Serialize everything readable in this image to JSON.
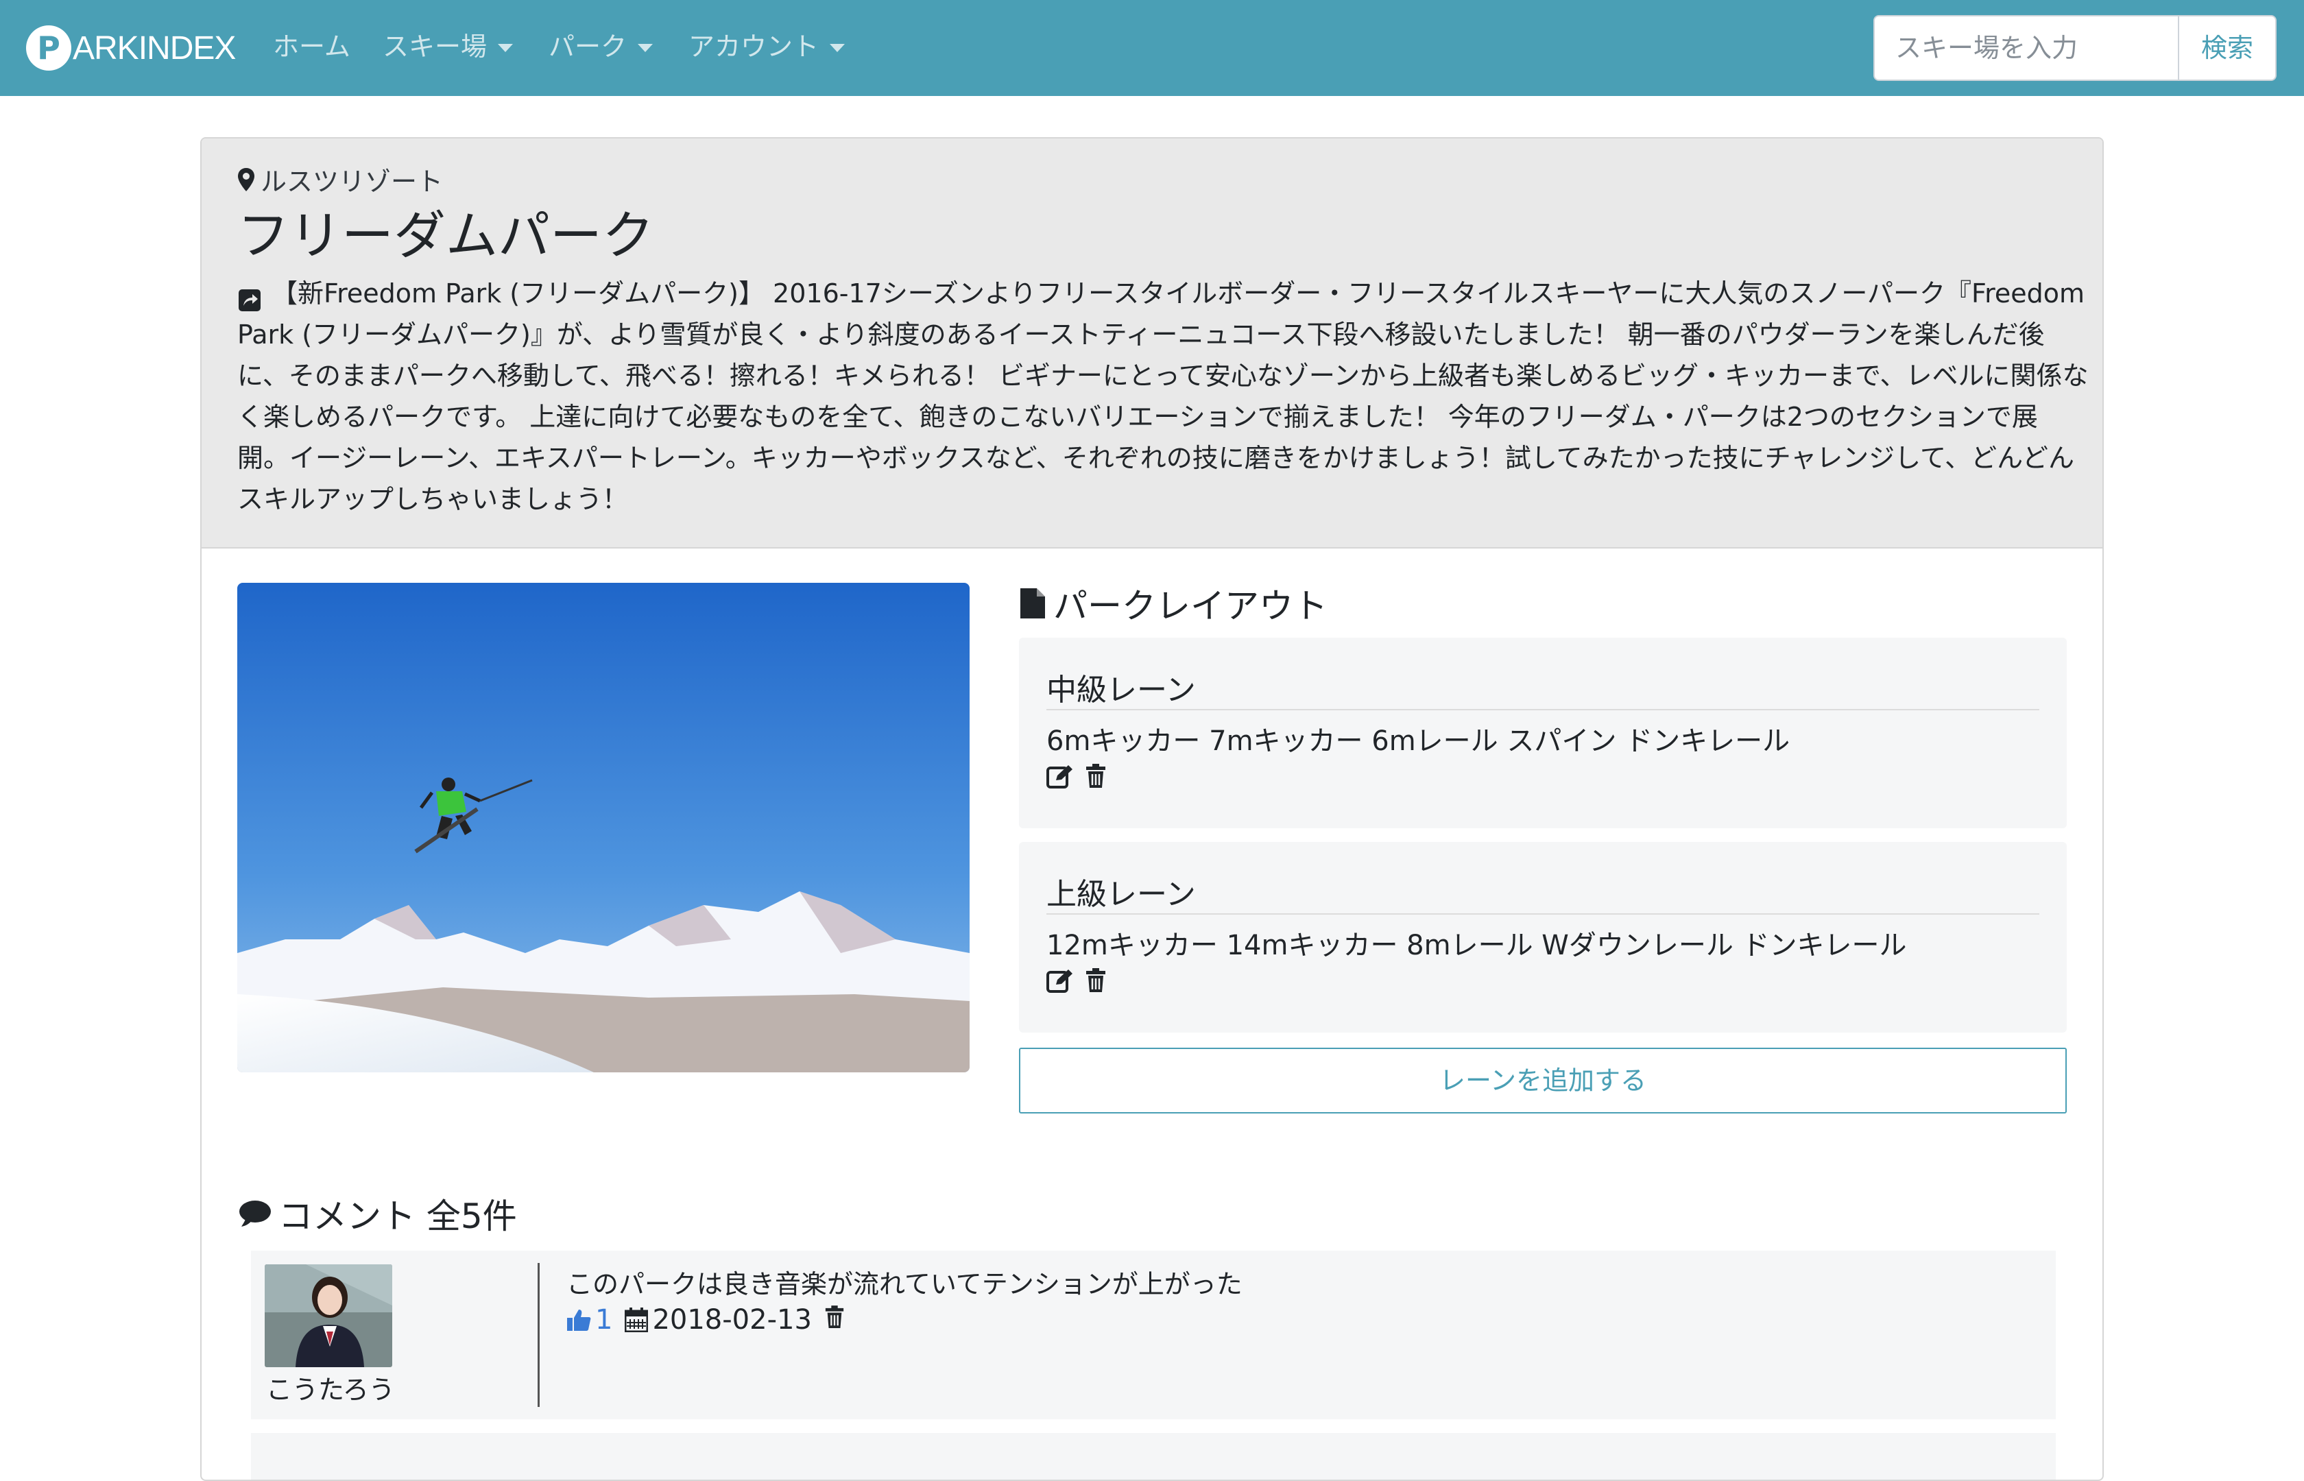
{
  "navbar": {
    "brand_initial": "P",
    "brand_text": "ARKINDEX",
    "items": [
      {
        "label": "ホーム",
        "dropdown": false
      },
      {
        "label": "スキー場",
        "dropdown": true
      },
      {
        "label": "パーク",
        "dropdown": true
      },
      {
        "label": "アカウント",
        "dropdown": true
      }
    ],
    "search_placeholder": "スキー場を入力",
    "search_button": "検索"
  },
  "park": {
    "resort": "ルスツリゾート",
    "title": "フリーダムパーク",
    "description": "【新Freedom Park (フリーダムパーク)】 2016-17シーズンよりフリースタイルボーダー・フリースタイルスキーヤーに大人気のスノーパーク『Freedom Park (フリーダムパーク)』が、より雪質が良く・より斜度のあるイーストティーニュコース下段へ移設いたしました！ 朝一番のパウダーランを楽しんだ後に、そのままパークへ移動して、飛べる！擦れる！キメられる！ ビギナーにとって安心なゾーンから上級者も楽しめるビッグ・キッカーまで、レベルに関係なく楽しめるパークです。 上達に向けて必要なものを全て、飽きのこないバリエーションで揃えました！ 今年のフリーダム・パークは2つのセクションで展開。イージーレーン、エキスパートレーン。キッカーやボックスなど、それぞれの技に磨きをかけましょう！試してみたかった技にチャレンジして、どんどんスキルアップしちゃいましょう！"
  },
  "layout": {
    "title": "パークレイアウト",
    "lanes": [
      {
        "name": "中級レーン",
        "features": "6mキッカー 7mキッカー 6mレール スパイン ドンキレール"
      },
      {
        "name": "上級レーン",
        "features": "12mキッカー 14mキッカー 8mレール Wダウンレール ドンキレール"
      }
    ],
    "add_lane_label": "レーンを追加する"
  },
  "comments": {
    "title": "コメント 全5件",
    "items": [
      {
        "user": "こうたろう",
        "text": "このパークは良き音楽が流れていてテンションが上がった",
        "likes": "1",
        "date": "2018-02-13"
      }
    ]
  },
  "colors": {
    "navbar": "#4a9fb5",
    "header_bg": "#e9e9e9",
    "lane_bg": "#f5f6f7",
    "like": "#3a7bd5"
  }
}
